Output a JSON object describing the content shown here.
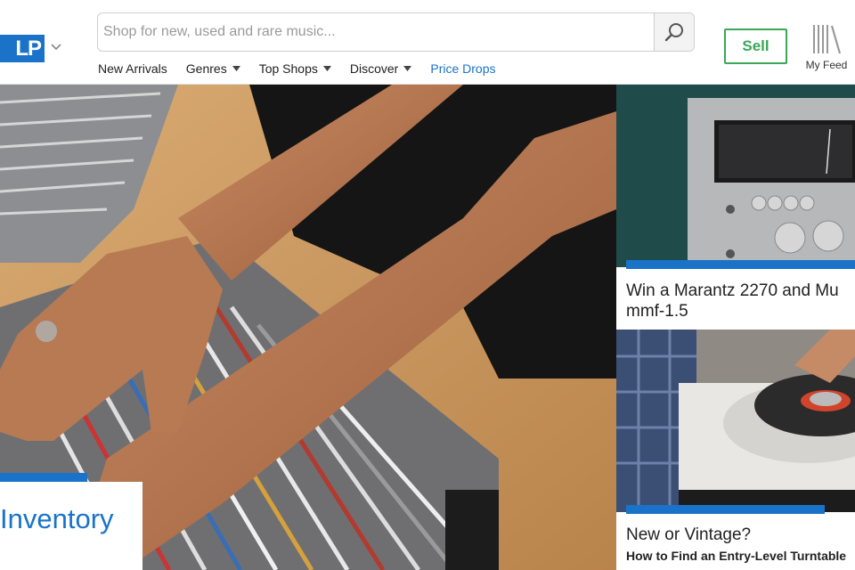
{
  "header": {
    "logo_text": "LP",
    "search": {
      "placeholder": "Shop for new, used and rare music...",
      "value": ""
    },
    "nav": [
      {
        "label": "New Arrivals",
        "has_caret": false
      },
      {
        "label": "Genres",
        "has_caret": true
      },
      {
        "label": "Top Shops",
        "has_caret": true
      },
      {
        "label": "Discover",
        "has_caret": true
      },
      {
        "label": "Price Drops",
        "has_caret": false,
        "highlight": true
      }
    ],
    "sell_label": "Sell",
    "my_feed_label": "My Feed"
  },
  "hero": {
    "caption_title": "Inventory"
  },
  "cards": [
    {
      "title_line1": "Win a Marantz 2270 and Mu",
      "title_line2": "mmf-1.5"
    },
    {
      "title": "New or Vintage?",
      "subtitle": "How to Find an Entry-Level Turntable"
    }
  ],
  "colors": {
    "brand_blue": "#1a73c8",
    "sell_green": "#3aa856"
  }
}
